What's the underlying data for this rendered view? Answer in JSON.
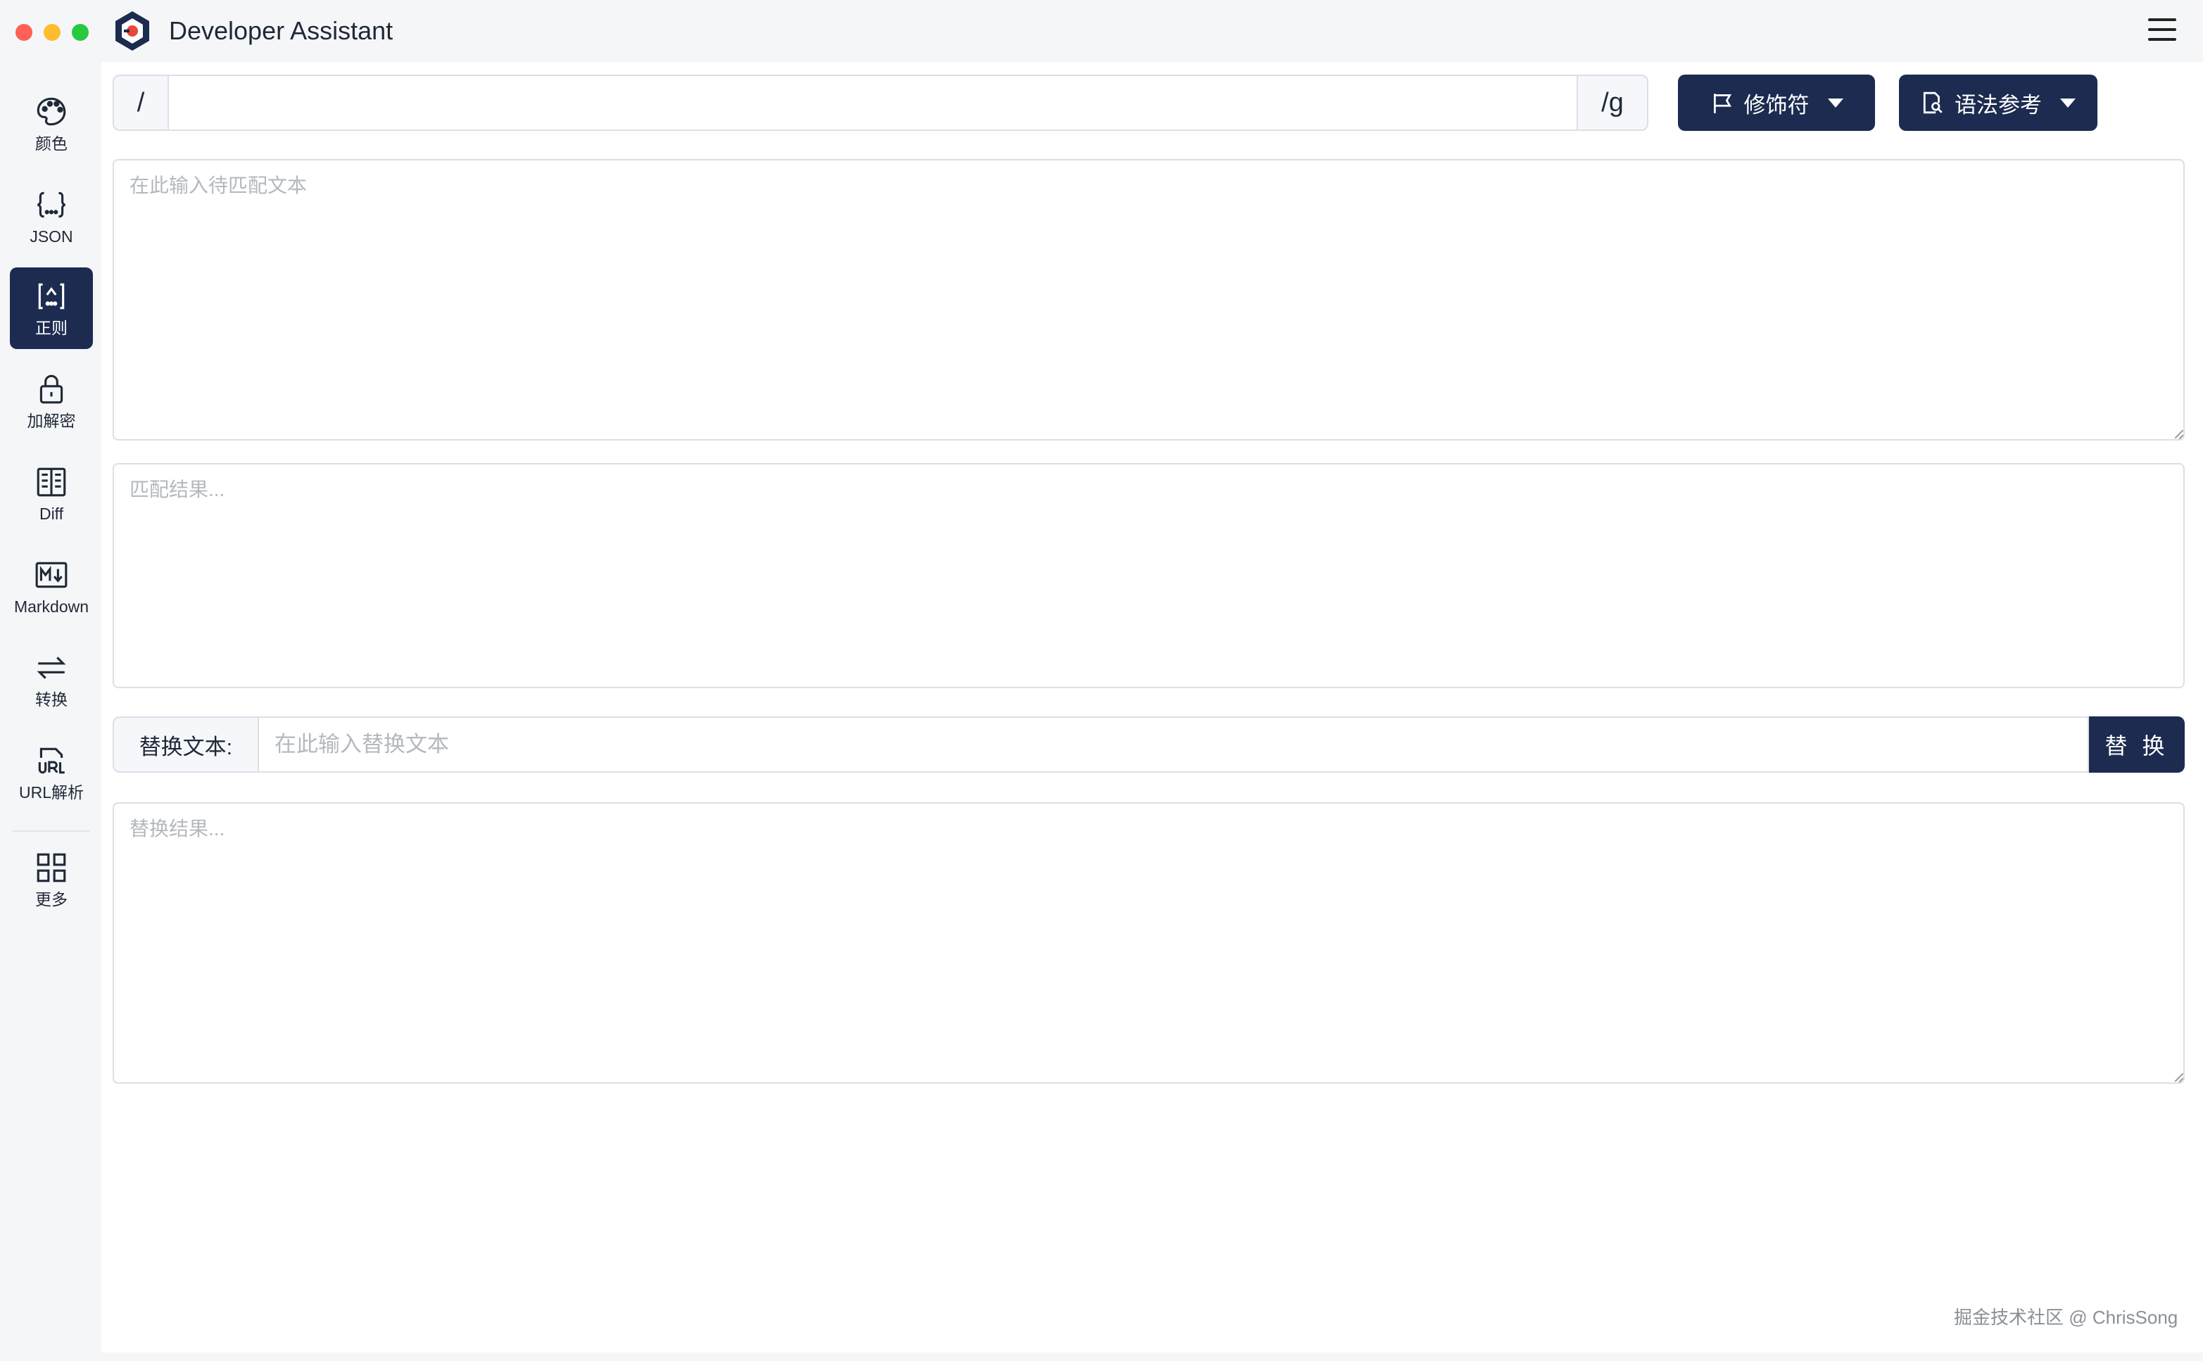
{
  "app": {
    "title": "Developer Assistant"
  },
  "sidebar": {
    "items": [
      {
        "label": "颜色",
        "icon": "palette-icon"
      },
      {
        "label": "JSON",
        "icon": "braces-icon"
      },
      {
        "label": "正则",
        "icon": "regex-icon",
        "active": true
      },
      {
        "label": "加解密",
        "icon": "lock-icon"
      },
      {
        "label": "Diff",
        "icon": "diff-icon"
      },
      {
        "label": "Markdown",
        "icon": "markdown-icon"
      },
      {
        "label": "转换",
        "icon": "swap-icon"
      },
      {
        "label": "URL解析",
        "icon": "url-icon"
      },
      {
        "label": "更多",
        "icon": "grid-icon"
      }
    ]
  },
  "regex": {
    "prefix": "/",
    "suffix": "/g",
    "value": "",
    "modifiers_label": "修饰符",
    "syntax_label": "语法参考"
  },
  "source": {
    "placeholder": "在此输入待匹配文本"
  },
  "match_result": {
    "placeholder": "匹配结果..."
  },
  "replace": {
    "label": "替换文本:",
    "placeholder": "在此输入替换文本",
    "button_label": "替 换",
    "result_placeholder": "替换结果..."
  },
  "watermark": "掘金技术社区 @ ChrisSong",
  "colors": {
    "accent": "#1c2b4f",
    "border": "#dcdfe6"
  }
}
